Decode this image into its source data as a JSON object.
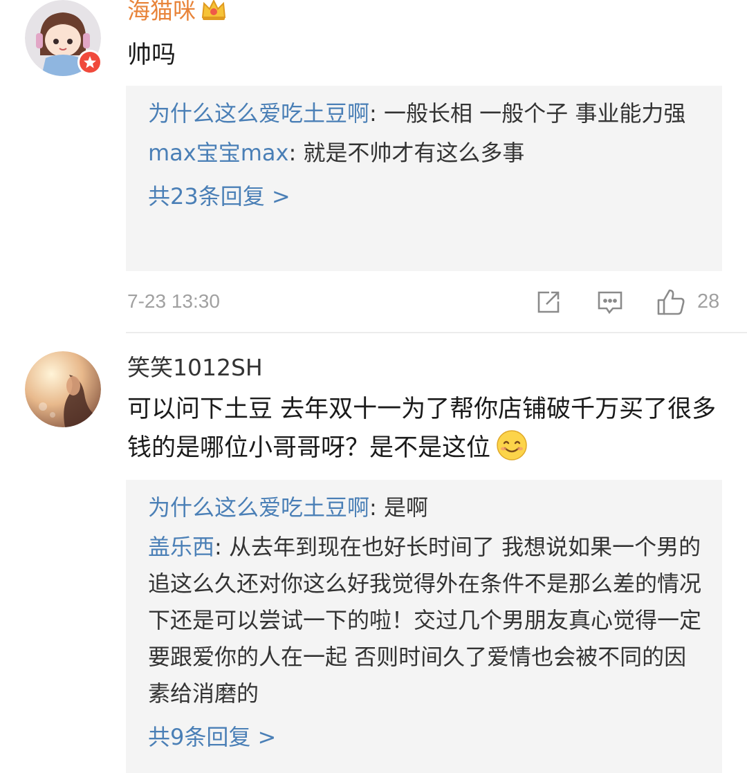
{
  "comments": [
    {
      "username": "海猫咪",
      "text": "帅吗",
      "replies": [
        {
          "user": "为什么这么爱吃土豆啊",
          "sep": ": ",
          "text": "一般长相 一般个子 事业能力强"
        },
        {
          "user": "max宝宝max",
          "sep": ": ",
          "text": "就是不帅才有这么多事"
        }
      ],
      "more_replies": "共23条回复 >",
      "timestamp": "7-23 13:30",
      "like_count": "28"
    },
    {
      "username": "笑笑1012SH",
      "text": "可以问下土豆 去年双十一为了帮你店铺破千万买了很多钱的是哪位小哥哥呀？是不是这位",
      "replies": [
        {
          "user": "为什么这么爱吃土豆啊",
          "sep": ": ",
          "text": "是啊"
        },
        {
          "user": "盖乐西",
          "sep": ": ",
          "text": "从去年到现在也好长时间了 我想说如果一个男的追这么久还对你这么好我觉得外在条件不是那么差的情况下还是可以尝试一下的啦！交过几个男朋友真心觉得一定要跟爱你的人在一起 否则时间久了爱情也会被不同的因素给消磨的"
        }
      ],
      "more_replies": "共9条回复 >"
    }
  ],
  "colors": {
    "reply_user": "#4a7fb6",
    "vip_username": "#e8843a",
    "reply_bg": "#f4f4f4",
    "meta": "#a0a0a0"
  },
  "icons": [
    "crown-icon",
    "vip-badge",
    "share-icon",
    "comment-icon",
    "like-icon",
    "smile-icon"
  ]
}
